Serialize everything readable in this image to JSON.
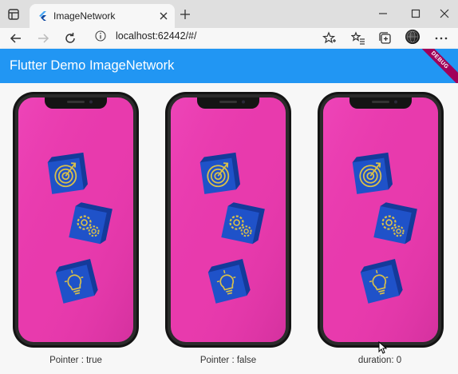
{
  "browser": {
    "tab_title": "ImageNetwork",
    "url": "localhost:62442/#/"
  },
  "app": {
    "title": "Flutter Demo ImageNetwork",
    "debug_banner": "DEBUG"
  },
  "phones": [
    {
      "caption": "Pointer : true"
    },
    {
      "caption": "Pointer : false"
    },
    {
      "caption": "duration: 0"
    }
  ],
  "colors": {
    "appbar": "#2196f3",
    "screen": "#e83aad",
    "cube": "#1f52c9",
    "icon_line": "#d9c04a"
  },
  "icons": {
    "phone_1_cubes": [
      "target-icon",
      "gears-icon",
      "lightbulb-icon"
    ],
    "phone_2_cubes": [
      "target-icon",
      "gears-icon",
      "lightbulb-icon"
    ],
    "phone_3_cubes": [
      "target-icon",
      "gears-icon",
      "lightbulb-icon"
    ]
  }
}
